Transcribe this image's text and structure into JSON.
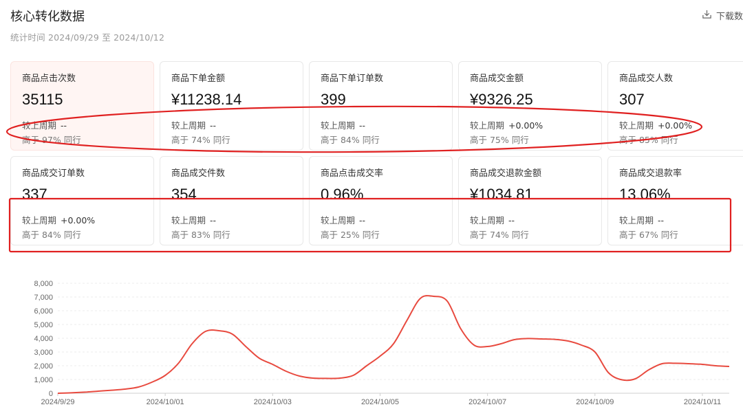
{
  "header": {
    "title": "核心转化数据",
    "subtitle": "统计时间 2024/09/29 至 2024/10/12"
  },
  "toolbar": {
    "download_label": "下载数"
  },
  "cards": [
    {
      "label": "商品点击次数",
      "value": "35115",
      "compare_label": "较上周期",
      "compare_value": "--",
      "peer": "高于 97% 同行"
    },
    {
      "label": "商品下单金额",
      "value": "¥11238.14",
      "compare_label": "较上周期",
      "compare_value": "--",
      "peer": "高于 74% 同行"
    },
    {
      "label": "商品下单订单数",
      "value": "399",
      "compare_label": "较上周期",
      "compare_value": "--",
      "peer": "高于 84% 同行"
    },
    {
      "label": "商品成交金额",
      "value": "¥9326.25",
      "compare_label": "较上周期",
      "compare_value": "+0.00%",
      "peer": "高于 75% 同行"
    },
    {
      "label": "商品成交人数",
      "value": "307",
      "compare_label": "较上周期",
      "compare_value": "+0.00%",
      "peer": "高于 85% 同行"
    },
    {
      "label": "商品成交订单数",
      "value": "337",
      "compare_label": "较上周期",
      "compare_value": "+0.00%",
      "peer": "高于 84% 同行"
    },
    {
      "label": "商品成交件数",
      "value": "354",
      "compare_label": "较上周期",
      "compare_value": "--",
      "peer": "高于 83% 同行"
    },
    {
      "label": "商品点击成交率",
      "value": "0.96%",
      "compare_label": "较上周期",
      "compare_value": "--",
      "peer": "高于 25% 同行"
    },
    {
      "label": "商品成交退款金额",
      "value": "¥1034.81",
      "compare_label": "较上周期",
      "compare_value": "--",
      "peer": "高于 74% 同行"
    },
    {
      "label": "商品成交退款率",
      "value": "13.06%",
      "compare_label": "较上周期",
      "compare_value": "--",
      "peer": "高于 67% 同行"
    }
  ],
  "colors": {
    "accent": "#e84a3f",
    "annotation": "#e02020",
    "active_card_bg": "#fff5f3"
  },
  "chart_data": {
    "type": "line",
    "ylim": [
      0,
      8000
    ],
    "yticks": [
      "0",
      "1,000",
      "2,000",
      "3,000",
      "4,000",
      "5,000",
      "6,000",
      "7,000",
      "8,000"
    ],
    "xtick_labels": [
      "2024/9/29",
      "2024/10/01",
      "2024/10/03",
      "2024/10/05",
      "2024/10/07",
      "2024/10/09",
      "2024/10/11"
    ],
    "series": [
      {
        "x": [
          0,
          0.25,
          0.5,
          0.75,
          1,
          1.25,
          1.5,
          1.75,
          2,
          2.25,
          2.5,
          2.75,
          3,
          3.25,
          3.5,
          3.75,
          4,
          4.25,
          4.5,
          4.75,
          5,
          5.25,
          5.5,
          5.75,
          6,
          6.25,
          6.5,
          6.75,
          7,
          7.25,
          7.5,
          7.75,
          8,
          8.25,
          8.5,
          8.75,
          9,
          9.25,
          9.5,
          9.75,
          10,
          10.25,
          10.5,
          10.75,
          11,
          11.25,
          11.5,
          11.75,
          12,
          12.25,
          12.5
        ],
        "y": [
          0,
          30,
          80,
          150,
          220,
          300,
          450,
          800,
          1300,
          2200,
          3600,
          4500,
          4550,
          4300,
          3400,
          2550,
          2100,
          1600,
          1250,
          1100,
          1080,
          1100,
          1300,
          2000,
          2700,
          3600,
          5300,
          6900,
          7050,
          6700,
          4700,
          3500,
          3400,
          3600,
          3900,
          3980,
          3950,
          3920,
          3800,
          3500,
          3000,
          1500,
          980,
          1050,
          1700,
          2150,
          2180,
          2150,
          2100,
          2000,
          1950
        ]
      }
    ]
  }
}
